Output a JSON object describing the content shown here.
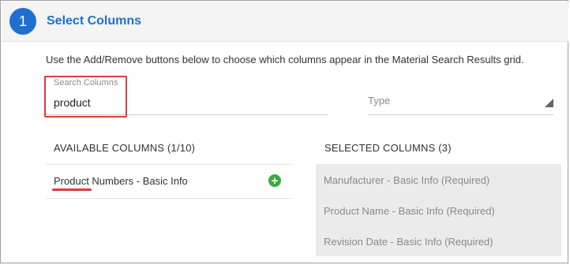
{
  "header": {
    "step_number": "1",
    "title": "Select Columns"
  },
  "instructions": "Use the Add/Remove buttons below to choose which columns appear in the Material Search Results grid.",
  "search": {
    "label": "Search Columns",
    "value": "product"
  },
  "type_select": {
    "placeholder": "Type"
  },
  "available": {
    "heading": "AVAILABLE COLUMNS (1/10)",
    "items": [
      {
        "label": "Product Numbers - Basic Info",
        "action_icon": "plus-circle-icon"
      }
    ]
  },
  "selected": {
    "heading": "SELECTED COLUMNS (3)",
    "items": [
      {
        "label": "Manufacturer - Basic Info (Required)"
      },
      {
        "label": "Product Name - Basic Info (Required)"
      },
      {
        "label": "Revision Date - Basic Info (Required)"
      }
    ]
  },
  "colors": {
    "accent": "#1f6fd0",
    "highlight": "#e0393e",
    "add": "#3aa93e"
  }
}
